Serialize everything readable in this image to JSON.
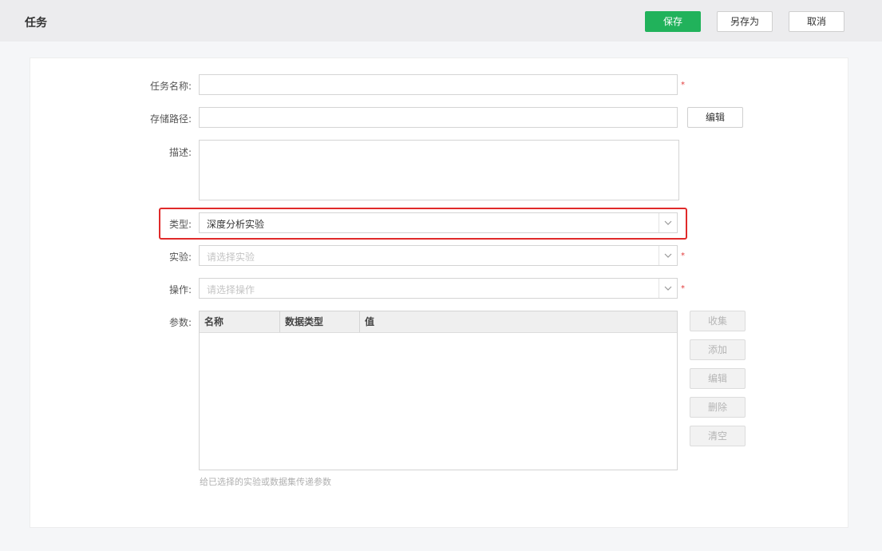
{
  "header": {
    "title": "任务",
    "save_label": "保存",
    "save_as_label": "另存为",
    "cancel_label": "取消"
  },
  "colors": {
    "primary": "#21b25b",
    "required": "#e23b3b",
    "highlight": "#e02a2a"
  },
  "form": {
    "task_name": {
      "label": "任务名称:",
      "value": ""
    },
    "storage_path": {
      "label": "存储路径:",
      "value": "",
      "edit_label": "编辑"
    },
    "description": {
      "label": "描述:",
      "value": ""
    },
    "type": {
      "label": "类型:",
      "value": "深度分析实验"
    },
    "experiment": {
      "label": "实验:",
      "placeholder": "请选择实验"
    },
    "operation": {
      "label": "操作:",
      "placeholder": "请选择操作"
    },
    "params": {
      "label": "参数:",
      "columns": [
        "名称",
        "数据类型",
        "值"
      ],
      "rows": [],
      "hint": "给已选择的实验或数据集传递参数",
      "buttons": {
        "collect": "收集",
        "add": "添加",
        "edit": "编辑",
        "delete": "删除",
        "clear": "清空"
      }
    },
    "required_mark": "*"
  }
}
